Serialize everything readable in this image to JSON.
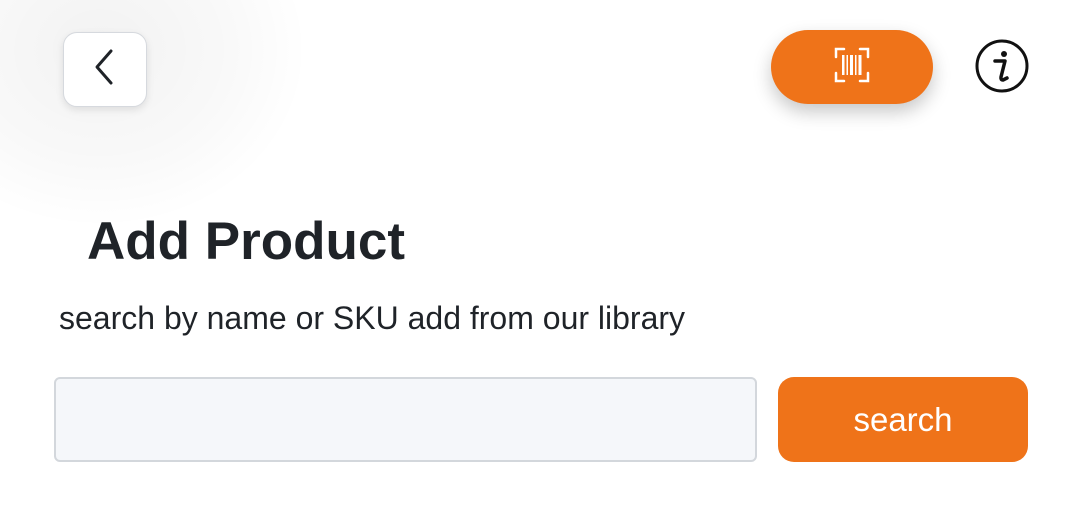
{
  "header": {
    "back_button": {
      "icon": "chevron-left-icon"
    },
    "scan_button": {
      "icon": "barcode-scan-icon",
      "color": "#ef7319"
    },
    "info_button": {
      "icon": "info-icon"
    }
  },
  "main": {
    "title": "Add Product",
    "subtitle": "search by name or SKU add from our library",
    "search": {
      "value": "",
      "placeholder": "",
      "button_label": "search",
      "button_color": "#ef7319"
    }
  },
  "colors": {
    "accent": "#ef7319",
    "text": "#1f2328",
    "input_background": "#f5f7fa"
  }
}
